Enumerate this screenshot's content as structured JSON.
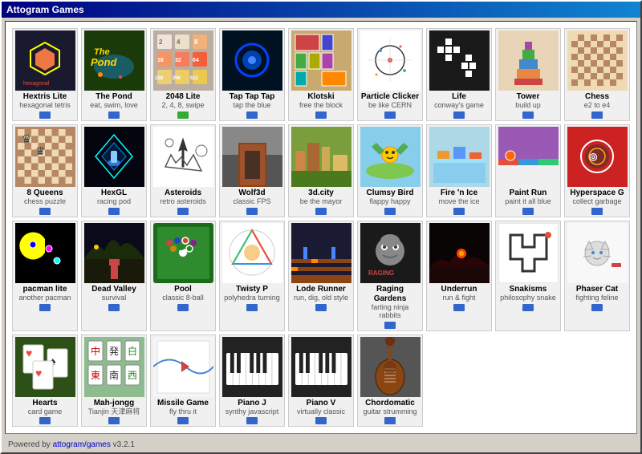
{
  "window": {
    "title": "Attogram Games"
  },
  "games": [
    {
      "id": "hextris",
      "title": "Hextris Lite",
      "subtitle": "hexagonal tetris",
      "badge": "blue",
      "color": "#1a1a2e"
    },
    {
      "id": "pond",
      "title": "The Pond",
      "subtitle": "eat, swim, love",
      "badge": "blue",
      "color": "#2d5016"
    },
    {
      "id": "2048",
      "title": "2048 Lite",
      "subtitle": "2, 4, 8, swipe",
      "badge": "green",
      "color": "#bbada0"
    },
    {
      "id": "taptap",
      "title": "Tap Tap Tap",
      "subtitle": "tap the blue",
      "badge": "blue",
      "color": "#001a33"
    },
    {
      "id": "klotski",
      "title": "Klotski",
      "subtitle": "free the block",
      "badge": "blue",
      "color": "#c8a96e"
    },
    {
      "id": "particle",
      "title": "Particle Clicker",
      "subtitle": "be like CERN",
      "badge": "blue",
      "color": "#ffffff"
    },
    {
      "id": "life",
      "title": "Life",
      "subtitle": "conway's game",
      "badge": "blue",
      "color": "#1a1a1a"
    },
    {
      "id": "tower",
      "title": "Tower",
      "subtitle": "build up",
      "badge": "blue",
      "color": "#e8d5b7"
    },
    {
      "id": "chess",
      "title": "Chess",
      "subtitle": "e2 to e4",
      "badge": "blue",
      "color": "#f0d9b5"
    },
    {
      "id": "8queens",
      "title": "8 Queens",
      "subtitle": "chess puzzle",
      "badge": "blue",
      "color": "#b58863"
    },
    {
      "id": "hexgl",
      "title": "HexGL",
      "subtitle": "racing pod",
      "badge": "blue",
      "color": "#0a0a1a"
    },
    {
      "id": "asteroids",
      "title": "Asteroids",
      "subtitle": "retro asteroids",
      "badge": "blue",
      "color": "#ffffff"
    },
    {
      "id": "wolf3d",
      "title": "Wolf3d",
      "subtitle": "classic FPS",
      "badge": "blue",
      "color": "#333333"
    },
    {
      "id": "3dcity",
      "title": "3d.city",
      "subtitle": "be the mayor",
      "badge": "blue",
      "color": "#7a9e3c"
    },
    {
      "id": "clumsy",
      "title": "Clumsy Bird",
      "subtitle": "flappy happy",
      "badge": "blue",
      "color": "#87ceeb"
    },
    {
      "id": "firenice",
      "title": "Fire 'n Ice",
      "subtitle": "move the ice",
      "badge": "blue",
      "color": "#add8e6"
    },
    {
      "id": "paintrun",
      "title": "Paint Run",
      "subtitle": "paint it all blue",
      "badge": "blue",
      "color": "#9b59b6"
    },
    {
      "id": "hypspace",
      "title": "Hyperspace G",
      "subtitle": "collect garbage",
      "badge": "blue",
      "color": "#cc3333"
    },
    {
      "id": "pacman",
      "title": "pacman lite",
      "subtitle": "another pacman",
      "badge": "blue",
      "color": "#000000"
    },
    {
      "id": "deadvalley",
      "title": "Dead Valley",
      "subtitle": "survival",
      "badge": "blue",
      "color": "#1a1a2e"
    },
    {
      "id": "pool",
      "title": "Pool",
      "subtitle": "classic 8-ball",
      "badge": "blue",
      "color": "#1a6b1a"
    },
    {
      "id": "twisty",
      "title": "Twisty P",
      "subtitle": "polyhedra turning",
      "badge": "blue",
      "color": "#ffffff"
    },
    {
      "id": "lode",
      "title": "Lode Runner",
      "subtitle": "run, dig, old style",
      "badge": "blue",
      "color": "#333333"
    },
    {
      "id": "raging",
      "title": "Raging Gardens",
      "subtitle": "farting ninja rabbits",
      "badge": "blue",
      "color": "#1a1a1a"
    },
    {
      "id": "underrun",
      "title": "Underrun",
      "subtitle": "run & fight",
      "badge": "blue",
      "color": "#0a0505"
    },
    {
      "id": "snakisms",
      "title": "Snakisms",
      "subtitle": "philosophy snake",
      "badge": "blue",
      "color": "#ffffff"
    },
    {
      "id": "phasercat",
      "title": "Phaser Cat",
      "subtitle": "fighting feline",
      "badge": "blue",
      "color": "#f8f8f8"
    },
    {
      "id": "hearts",
      "title": "Hearts",
      "subtitle": "card game",
      "badge": "blue",
      "color": "#2d5016"
    },
    {
      "id": "mahjongg",
      "title": "Mah-jongg",
      "subtitle": "Tianjin 天津麻将",
      "badge": "blue",
      "color": "#8fbc8f"
    },
    {
      "id": "missile",
      "title": "Missile Game",
      "subtitle": "fly thru it",
      "badge": "blue",
      "color": "#f5f5f5"
    },
    {
      "id": "pianoj",
      "title": "Piano J",
      "subtitle": "synthy javascript",
      "badge": "blue",
      "color": "#222222"
    },
    {
      "id": "pianob",
      "title": "Piano V",
      "subtitle": "virtually classic",
      "badge": "blue",
      "color": "#222222"
    },
    {
      "id": "chord",
      "title": "Chordomatic",
      "subtitle": "guitar strumming",
      "badge": "blue",
      "color": "#555555"
    }
  ],
  "footer": {
    "text": "Powered by attogram/games v3.2.1",
    "link_text": "attogram/games",
    "link_url": "#"
  }
}
